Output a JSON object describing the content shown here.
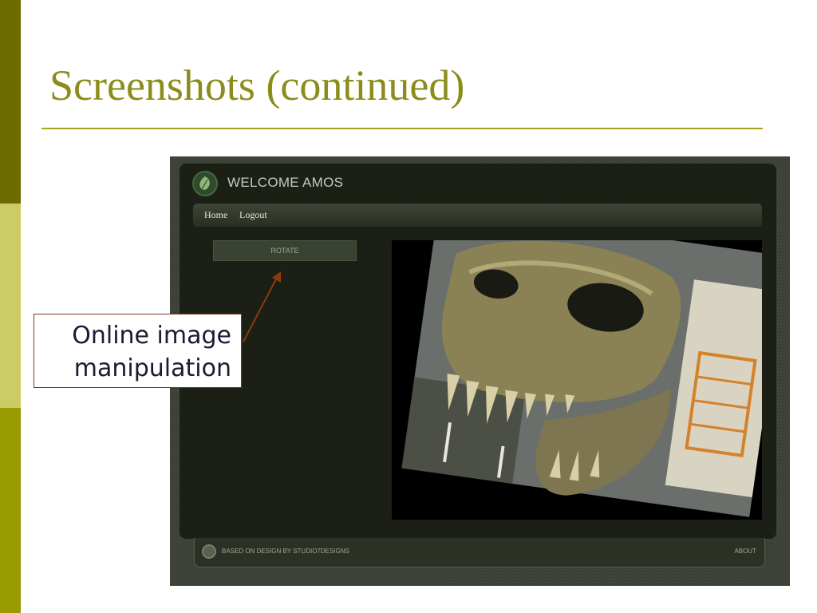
{
  "slide": {
    "title": "Screenshots (continued)"
  },
  "app": {
    "welcome": "WELCOME AMOS",
    "nav": [
      "Home",
      "Logout"
    ],
    "rotate_label": "ROTATE",
    "footer_text": "BASED ON DESIGN BY STUDIO7DESIGNS",
    "footer_about": "ABOUT",
    "photo_subject": "rotated dinosaur skull photo"
  },
  "callout": {
    "line1": "Online image",
    "line2": "manipulation"
  },
  "colors": {
    "accent_dark": "#6b6b00",
    "accent_light": "#cccc66",
    "accent_mid": "#999900",
    "title": "#8c8c1a",
    "arrow": "#8b3a0e"
  }
}
